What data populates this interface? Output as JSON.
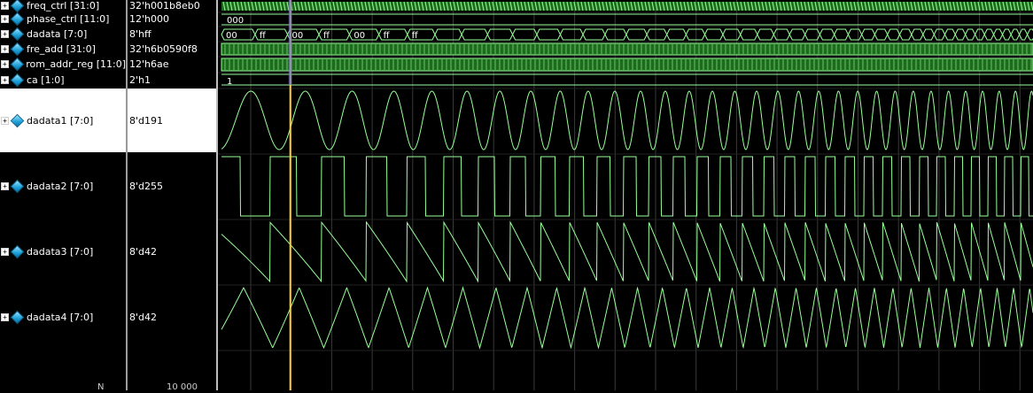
{
  "signals": [
    {
      "name": "freq_ctrl [31:0]",
      "value": "32'h001b8eb0"
    },
    {
      "name": "phase_ctrl [11:0]",
      "value": "12'h000"
    },
    {
      "name": "dadata [7:0]",
      "value": "8'hff"
    },
    {
      "name": "fre_add [31:0]",
      "value": "32'h6b0590f8"
    },
    {
      "name": "rom_addr_reg [11:0]",
      "value": "12'h6ae"
    },
    {
      "name": "ca [1:0]",
      "value": "2'h1"
    },
    {
      "name": "dadata1 [7:0]",
      "value": "8'd191"
    },
    {
      "name": "dadata2 [7:0]",
      "value": "8'd255"
    },
    {
      "name": "dadata3 [7:0]",
      "value": "8'd42"
    },
    {
      "name": "dadata4 [7:0]",
      "value": "8'd42"
    }
  ],
  "bus_labels": {
    "phase_ctrl": "000",
    "ca": "1",
    "dadata": [
      "00",
      "ff",
      "00",
      "ff",
      "00",
      "ff",
      "ff"
    ]
  },
  "bottom": {
    "name_fragment": "N",
    "value_fragment": "10 000"
  },
  "colors": {
    "wave": "#99ff99",
    "bus_fill": "#1e6b1e",
    "cursor": "#ffcc33",
    "grid": "#3a3a3a",
    "selected_bg": "#ffffff",
    "icon": "#1aa0d8"
  },
  "cursor_time_fraction": 0.0888,
  "icons": {
    "expand": "plus-box-icon",
    "signal": "diamond-signal-icon"
  }
}
